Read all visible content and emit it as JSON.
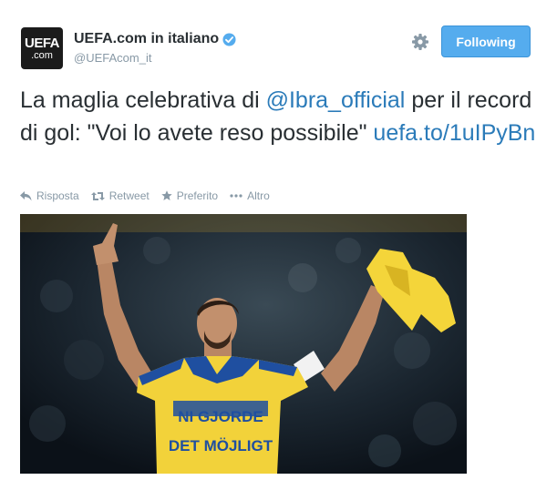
{
  "account": {
    "avatar_line1": "UEFA",
    "avatar_line2": ".com",
    "display_name": "UEFA.com in italiano",
    "handle": "@UEFAcom_it",
    "verified_icon": "verified-badge-icon"
  },
  "header": {
    "settings_icon": "gear-icon",
    "follow_label": "Following"
  },
  "tweet": {
    "text_part1": "La maglia celebrativa di ",
    "mention": "@Ibra_official",
    "text_part2": " per il record di gol: \"Voi lo avete reso possibile\" ",
    "link": "uefa.to/1uIPyBn"
  },
  "actions": {
    "reply": "Risposta",
    "retweet": "Retweet",
    "favorite": "Preferito",
    "more": "Altro"
  },
  "photo": {
    "jersey_line1": "NI GJORDE",
    "jersey_line2": "DET MÖJLIGT"
  },
  "colors": {
    "link": "#2b7bb9",
    "follow_button": "#55acee",
    "verified": "#55acee",
    "jersey_yellow": "#f2d23a",
    "jersey_blue": "#1f4fa0"
  }
}
